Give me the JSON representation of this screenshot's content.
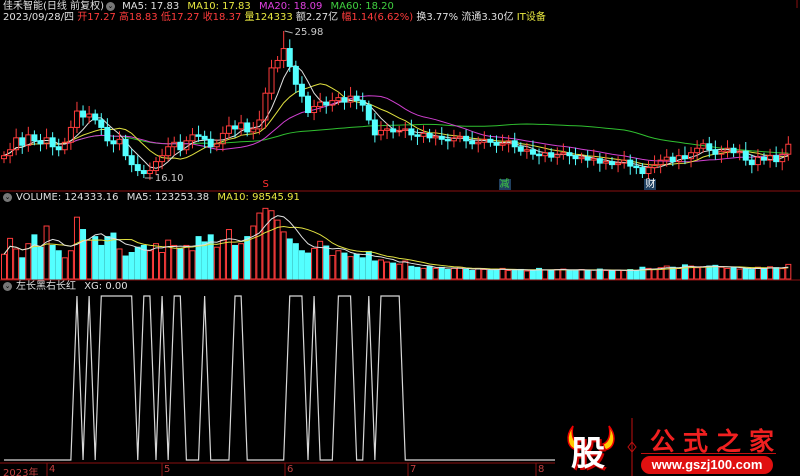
{
  "header": {
    "title": "佳禾智能(日线 前复权)",
    "ma5": "MA5: 17.83",
    "ma10": "MA10: 17.83",
    "ma20": "MA20: 18.09",
    "ma60": "MA60: 18.20",
    "date": "2023/09/28/四",
    "open": "开17.27",
    "high": "高18.83",
    "low": "低17.27",
    "close": "收18.37",
    "volume": "量124333",
    "amount": "额2.27亿",
    "change": "幅1.14(6.62%)",
    "turnover": "换3.77%",
    "float_cap": "流通3.30亿",
    "sector": "IT设备"
  },
  "price_panel": {
    "max_label": "25.98",
    "min_label": "16.10",
    "markers": [
      {
        "text": "S",
        "bar": 43,
        "color": "#ff3030"
      },
      {
        "text": "减",
        "bar": 82,
        "color": "#40d040"
      },
      {
        "text": "财",
        "bar": 106,
        "color": "#ffffff"
      }
    ]
  },
  "volume_panel": {
    "label": "VOLUME: 124333.16",
    "ma5": "MA5: 123253.38",
    "ma10": "MA10: 98545.91"
  },
  "indicator_panel": {
    "label": "左长黑右长红",
    "xg": "XG: 0.00"
  },
  "x_axis": [
    "2023年",
    "4",
    "5",
    "6",
    "7",
    "8"
  ],
  "logo": {
    "name": "公式之家",
    "char": "股",
    "url": "www.gszj100.com"
  },
  "colors": {
    "up": "#ff3c3c",
    "down": "#54ffff",
    "ma5": "#e0e0e0",
    "ma10": "#e0e040",
    "ma20": "#d040d0",
    "ma60": "#30c030",
    "separator": "#8a1010"
  },
  "chart_data": {
    "type": "candlestick",
    "price_range": [
      16.1,
      25.98
    ],
    "closes": [
      17.6,
      18.0,
      18.8,
      18.3,
      19.0,
      18.6,
      18.4,
      18.8,
      18.2,
      18.0,
      18.5,
      19.5,
      20.6,
      20.2,
      20.4,
      20.0,
      19.5,
      18.6,
      18.4,
      18.7,
      17.6,
      17.0,
      16.6,
      16.4,
      16.6,
      17.2,
      17.6,
      18.2,
      18.5,
      18.0,
      18.6,
      19.0,
      18.9,
      18.7,
      18.2,
      18.4,
      19.1,
      19.6,
      19.4,
      19.8,
      19.2,
      19.4,
      20.0,
      21.8,
      23.5,
      24.0,
      24.8,
      23.6,
      22.4,
      21.6,
      20.5,
      20.9,
      21.2,
      21.0,
      21.3,
      21.5,
      21.2,
      21.6,
      21.3,
      21.0,
      20.0,
      19.0,
      19.3,
      19.4,
      19.2,
      19.3,
      19.4,
      19.0,
      18.9,
      19.1,
      18.8,
      18.9,
      18.7,
      18.6,
      18.8,
      18.9,
      18.6,
      18.4,
      18.5,
      18.7,
      18.5,
      18.3,
      18.4,
      18.6,
      18.2,
      17.9,
      18.0,
      17.7,
      17.6,
      17.8,
      17.5,
      17.7,
      17.8,
      17.6,
      17.4,
      17.5,
      17.3,
      17.4,
      17.1,
      17.2,
      17.0,
      17.1,
      17.3,
      16.9,
      16.8,
      16.4,
      16.8,
      17.0,
      17.3,
      17.5,
      17.2,
      17.6,
      17.4,
      17.8,
      18.1,
      18.4,
      18.0,
      17.7,
      17.9,
      18.1,
      17.8,
      17.9,
      17.3,
      17.0,
      17.5,
      17.3,
      17.6,
      17.2,
      17.7,
      18.37
    ],
    "max_bar": 46,
    "min_bar": 23,
    "volume_k": [
      210,
      345,
      255,
      180,
      300,
      375,
      270,
      450,
      285,
      240,
      180,
      240,
      525,
      420,
      330,
      360,
      285,
      360,
      390,
      255,
      195,
      225,
      270,
      285,
      240,
      300,
      225,
      330,
      285,
      255,
      285,
      240,
      360,
      315,
      375,
      270,
      330,
      420,
      285,
      300,
      360,
      450,
      560,
      600,
      580,
      500,
      400,
      340,
      300,
      240,
      220,
      260,
      320,
      280,
      200,
      240,
      220,
      190,
      210,
      180,
      234,
      153,
      162,
      144,
      135,
      126,
      153,
      108,
      99,
      90,
      108,
      90,
      99,
      81,
      90,
      99,
      81,
      72,
      90,
      81,
      72,
      81,
      90,
      72,
      76,
      81,
      68,
      72,
      90,
      76,
      76,
      80,
      84,
      72,
      76,
      80,
      70,
      76,
      84,
      72,
      68,
      76,
      72,
      80,
      70,
      100,
      90,
      84,
      96,
      110,
      100,
      90,
      120,
      110,
      96,
      104,
      110,
      116,
      100,
      90,
      96,
      84,
      90,
      80,
      100,
      92,
      104,
      96,
      88,
      124
    ],
    "volume_max_k": 620,
    "xg_high_bars": [
      12,
      14,
      16,
      17,
      18,
      19,
      20,
      21,
      23,
      24,
      26,
      28,
      29,
      33,
      38,
      39,
      47,
      48,
      49,
      51,
      55,
      56,
      57,
      60,
      62,
      63,
      64,
      65
    ],
    "xg_bars": 91
  }
}
